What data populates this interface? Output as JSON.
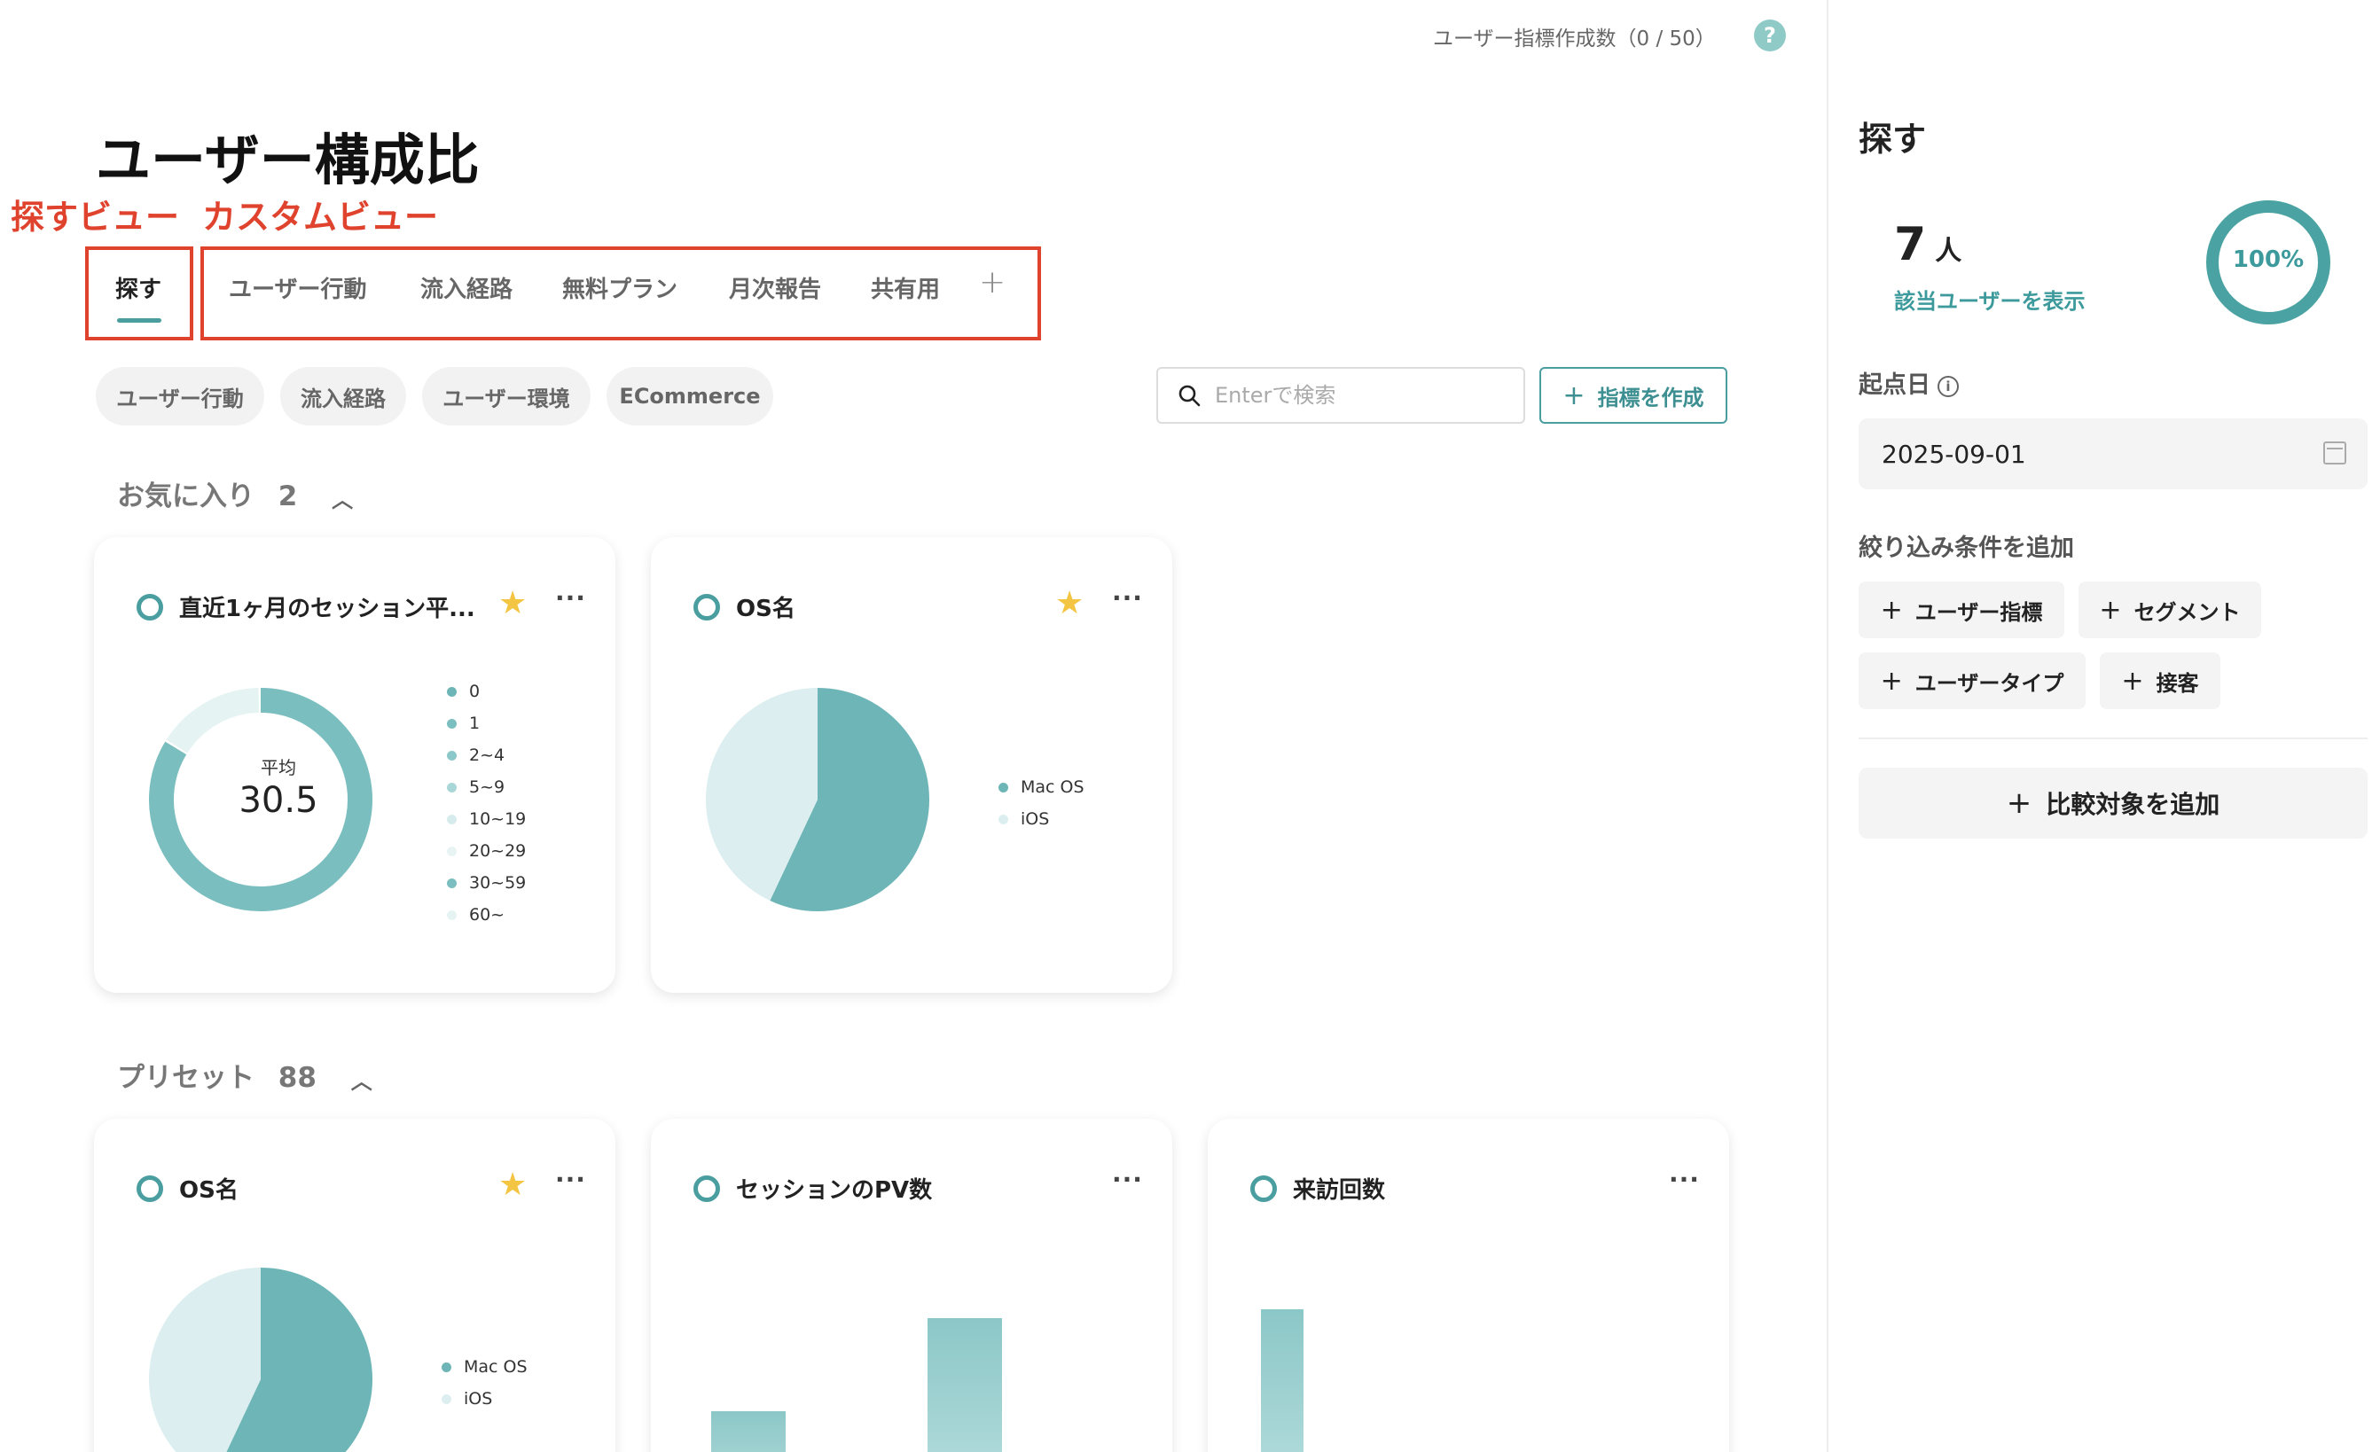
{
  "topbar": {
    "metric_count_text": "ユーザー指標作成数（0 / 50）",
    "help_icon": "?"
  },
  "page": {
    "title": "ユーザー構成比"
  },
  "annotations": {
    "explore_view_label": "探すビュー",
    "custom_view_label": "カスタムビュー",
    "color": "#e0432d"
  },
  "tabs": [
    {
      "label": "探す",
      "active": true
    },
    {
      "label": "ユーザー行動"
    },
    {
      "label": "流入経路"
    },
    {
      "label": "無料プラン"
    },
    {
      "label": "月次報告"
    },
    {
      "label": "共有用"
    }
  ],
  "tab_add_icon": "+",
  "chips": [
    "ユーザー行動",
    "流入経路",
    "ユーザー環境",
    "ECommerce"
  ],
  "search": {
    "placeholder": "Enterで検索"
  },
  "create_button": "指標を作成",
  "favorites": {
    "label": "お気に入り",
    "count": "2"
  },
  "presets": {
    "label": "プリセット",
    "count": "88"
  },
  "cards": {
    "session_avg": {
      "title": "直近1ヶ月のセッション平...",
      "center_label": "平均",
      "center_value": "30.5",
      "legend": [
        "0",
        "1",
        "2~4",
        "5~9",
        "10~19",
        "20~29",
        "30~59",
        "60~"
      ],
      "starred": true
    },
    "os_fav": {
      "title": "OS名",
      "legend": [
        "Mac OS",
        "iOS"
      ],
      "starred": true
    },
    "os_preset": {
      "title": "OS名",
      "legend": [
        "Mac OS",
        "iOS"
      ],
      "starred": true
    },
    "session_pv": {
      "title": "セッションのPV数"
    },
    "visit_count": {
      "title": "来訪回数"
    }
  },
  "chart_data": [
    {
      "type": "pie",
      "title": "直近1ヶ月のセッション平...",
      "categories": [
        "0",
        "1",
        "2~4",
        "5~9",
        "10~19",
        "20~29",
        "30~59",
        "60~"
      ],
      "values": [
        0,
        0,
        0,
        0,
        0,
        0,
        84,
        16
      ],
      "colors": [
        "#6db5b6",
        "#7bbebf",
        "#8cc8c9",
        "#a9d7d8",
        "#d6ecec",
        "#e8f4f4",
        "#7bbebf",
        "#e6f3f3"
      ]
    },
    {
      "type": "pie",
      "title": "OS名",
      "categories": [
        "Mac OS",
        "iOS"
      ],
      "values": [
        57,
        43
      ],
      "colors": [
        "#6db5b6",
        "#dceeef"
      ]
    },
    {
      "type": "pie",
      "title": "OS名",
      "categories": [
        "Mac OS",
        "iOS"
      ],
      "values": [
        57,
        43
      ],
      "colors": [
        "#6db5b6",
        "#dceeef"
      ]
    },
    {
      "type": "bar",
      "title": "セッションのPV数",
      "values": [
        2.2,
        0,
        4.3,
        1.2
      ]
    },
    {
      "type": "bar",
      "title": "来訪回数",
      "values": [
        4.5,
        0,
        1.1,
        0,
        1.1
      ]
    }
  ],
  "sidebar": {
    "title": "探す",
    "user_count": "7",
    "user_unit": "人",
    "show_users_link": "該当ユーザーを表示",
    "percent": "100%",
    "start_date_label": "起点日",
    "start_date_value": "2025-09-01",
    "filter_label": "絞り込み条件を追加",
    "filter_buttons": [
      "ユーザー指標",
      "セグメント",
      "ユーザータイプ",
      "接客"
    ],
    "compare_button": "比較対象を追加"
  },
  "colors": {
    "accent": "#4a9ea0",
    "star": "#f4c542"
  }
}
